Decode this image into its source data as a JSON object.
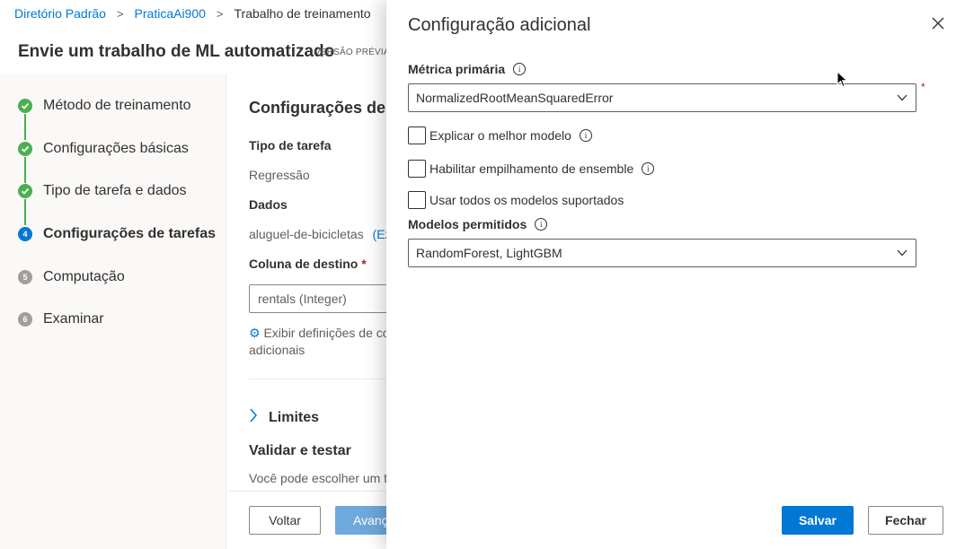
{
  "breadcrumb": {
    "items": [
      "Diretório Padrão",
      "PraticaAi900"
    ],
    "current": "Trabalho de treinamento"
  },
  "page": {
    "title": "Envie um trabalho de ML automatizado",
    "badge": "VERSÃO PRÉVIA"
  },
  "steps": [
    {
      "label": "Método de treinamento",
      "state": "done",
      "num": ""
    },
    {
      "label": "Configurações básicas",
      "state": "done",
      "num": ""
    },
    {
      "label": "Tipo de tarefa e dados",
      "state": "done",
      "num": ""
    },
    {
      "label": "Configurações de tarefas",
      "state": "active",
      "num": "4"
    },
    {
      "label": "Computação",
      "state": "todo",
      "num": "5"
    },
    {
      "label": "Examinar",
      "state": "todo",
      "num": "6"
    }
  ],
  "main": {
    "section_title": "Configurações de t",
    "task_type_label": "Tipo de tarefa",
    "task_type_value": "Regressão",
    "data_label": "Dados",
    "data_value": "aluguel-de-bicicletas",
    "data_link": "(Ex",
    "target_label": "Coluna de destino",
    "target_required": "*",
    "target_value": "rentals (Integer)",
    "advanced_link_line1": "Exibir definições de co",
    "advanced_link_line2": "adicionais",
    "limits_label": "Limites",
    "validate_title": "Validar e testar",
    "validate_text": "Você pode escolher um t",
    "back_button": "Voltar",
    "next_button": "Avanç"
  },
  "panel": {
    "title": "Configuração adicional",
    "metric_label": "Métrica primária",
    "metric_value": "NormalizedRootMeanSquaredError",
    "metric_required": "*",
    "checkbox_explain": "Explicar o melhor modelo",
    "checkbox_stacking": "Habilitar empilhamento de ensemble",
    "checkbox_all_models": "Usar todos os modelos suportados",
    "models_label": "Modelos permitidos",
    "models_value": "RandomForest, LightGBM",
    "save_button": "Salvar",
    "close_button": "Fechar",
    "info_glyph": "i"
  },
  "colors": {
    "accent": "#0078d4",
    "done": "#4caf50",
    "todo": "#a19f9d",
    "required": "#a4262c"
  }
}
